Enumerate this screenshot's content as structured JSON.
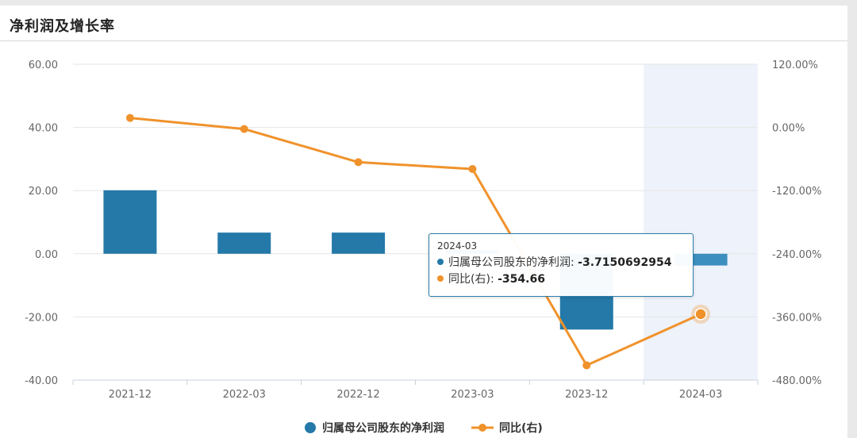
{
  "header": {
    "title": "净利润及增长率"
  },
  "colors": {
    "bar": "#2479a8",
    "line": "#f0922b",
    "highlight_band": "#eef2fa",
    "grid": "#e6e6e6",
    "tick": "#666666"
  },
  "chart_data": {
    "type": "bar",
    "categories": [
      "2021-12",
      "2022-03",
      "2022-12",
      "2023-03",
      "2023-12",
      "2024-03"
    ],
    "series": [
      {
        "name": "归属母公司股东的净利润",
        "type": "bar",
        "axis": "left",
        "values": [
          20.1,
          6.7,
          6.7,
          1.2,
          -24.0,
          -3.7150692954
        ]
      },
      {
        "name": "同比(右)",
        "type": "line",
        "axis": "right",
        "values": [
          18.0,
          -3.0,
          -66.0,
          -79.0,
          -452.0,
          -354.66
        ]
      }
    ],
    "y_left": {
      "min": -40,
      "max": 60,
      "ticks": [
        "60.00",
        "40.00",
        "20.00",
        "0.00",
        "-20.00",
        "-40.00"
      ]
    },
    "y_right": {
      "min": -480,
      "max": 120,
      "ticks": [
        "120.00%",
        "0.00%",
        "-120.00%",
        "-240.00%",
        "-360.00%",
        "-480.00%"
      ]
    },
    "grid": true,
    "legend_position": "bottom",
    "highlight_category": "2024-03"
  },
  "tooltip": {
    "title": "2024-03",
    "rows": [
      {
        "label": "归属母公司股东的净利润",
        "value": "-3.7150692954"
      },
      {
        "label": "同比(右)",
        "value": "-354.66"
      }
    ]
  }
}
